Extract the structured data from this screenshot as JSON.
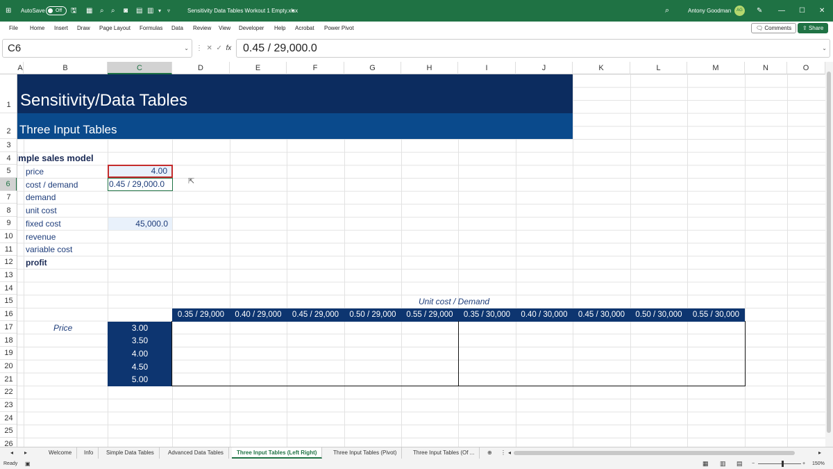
{
  "titlebar": {
    "autosave": "AutoSave",
    "autosave_state": "Off",
    "filename": "Sensitivity Data Tables Workout 1 Empty.xlsx",
    "user": "Antony Goodman",
    "initials": "AG"
  },
  "menu": [
    "File",
    "Home",
    "Insert",
    "Draw",
    "Page Layout",
    "Formulas",
    "Data",
    "Review",
    "View",
    "Developer",
    "Help",
    "Acrobat",
    "Power Pivot"
  ],
  "comments_label": "Comments",
  "share_label": "Share",
  "namebox": "C6",
  "formula": "0.45 / 29,000.0",
  "columns": [
    "A",
    "B",
    "C",
    "D",
    "E",
    "F",
    "G",
    "H",
    "I",
    "J",
    "K",
    "L",
    "M",
    "N",
    "O"
  ],
  "rows": [
    "1",
    "2",
    "3",
    "4",
    "5",
    "6",
    "7",
    "8",
    "9",
    "10",
    "11",
    "12",
    "13",
    "14",
    "15",
    "16",
    "17",
    "18",
    "19",
    "20",
    "21",
    "22",
    "23",
    "24",
    "25",
    "26"
  ],
  "sheet": {
    "title": "Sensitivity/Data Tables",
    "subtitle": "Three Input Tables",
    "model_header": "Simple sales model",
    "labels": [
      "price",
      "cost / demand",
      "demand",
      "unit cost",
      "fixed cost",
      "revenue",
      "variable cost",
      "profit"
    ],
    "price": "4.00",
    "cost_demand": "0.45 / 29,000.0",
    "fixed_cost": "45,000.0",
    "table_caption": "Unit cost / Demand",
    "table_headers": [
      "0.35 / 29,000",
      "0.40 / 29,000",
      "0.45 / 29,000",
      "0.50 / 29,000",
      "0.55 / 29,000",
      "0.35 / 30,000",
      "0.40 / 30,000",
      "0.45 / 30,000",
      "0.50 / 30,000",
      "0.55 / 30,000"
    ],
    "price_label": "Price",
    "price_values": [
      "3.00",
      "3.50",
      "4.00",
      "4.50",
      "5.00"
    ]
  },
  "tabs": [
    "Welcome",
    "Info",
    "Simple Data Tables",
    "Advanced Data Tables",
    "Three Input Tables (Left Right)",
    "Three Input Tables (Pivot)",
    "Three Input Tables (Of ..."
  ],
  "active_tab": "Three Input Tables (Left Right)",
  "status": {
    "ready": "Ready",
    "zoom": "150%"
  },
  "colors": {
    "excel_green": "#1f7244",
    "title_dark": "#0c2c5f",
    "title_blue": "#0a4a8c",
    "header_blue": "#0d3570"
  }
}
